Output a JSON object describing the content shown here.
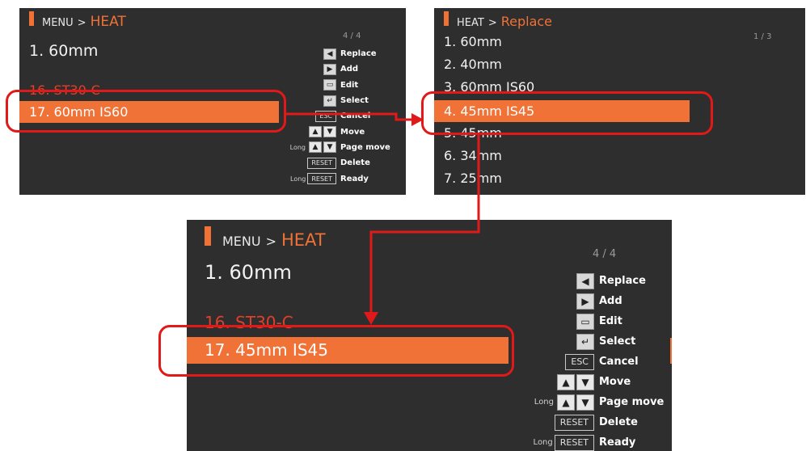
{
  "colors": {
    "accent": "#f07236",
    "highlight_border": "#e11919",
    "screen_bg": "#2e2e2e",
    "faded_item": "#e0402a"
  },
  "screen1": {
    "breadcrumb": {
      "parent": "MENU",
      "separator": ">",
      "current": "HEAT"
    },
    "page_indicator": "4 / 4",
    "items": [
      {
        "label": "1. 60mm",
        "state": "normal"
      },
      {
        "label": "16. ST30-C",
        "state": "faded"
      },
      {
        "label": "17. 60mm IS60",
        "state": "selected"
      }
    ],
    "commands": [
      {
        "long": "",
        "keys": [
          "left-arrow-icon"
        ],
        "label": "Replace"
      },
      {
        "long": "",
        "keys": [
          "right-arrow-icon"
        ],
        "label": "Add"
      },
      {
        "long": "",
        "keys": [
          "edit-icon"
        ],
        "label": "Edit"
      },
      {
        "long": "",
        "keys": [
          "enter-icon"
        ],
        "label": "Select"
      },
      {
        "long": "",
        "keys": [
          "ESC"
        ],
        "label": "Cancel"
      },
      {
        "long": "",
        "keys": [
          "up-arrow-icon",
          "down-arrow-icon"
        ],
        "label": "Move"
      },
      {
        "long": "Long",
        "keys": [
          "up-arrow-icon",
          "down-arrow-icon"
        ],
        "label": "Page move"
      },
      {
        "long": "",
        "keys": [
          "RESET"
        ],
        "label": "Delete"
      },
      {
        "long": "Long",
        "keys": [
          "RESET"
        ],
        "label": "Ready"
      }
    ]
  },
  "screen2": {
    "breadcrumb": {
      "parent": "HEAT",
      "separator": ">",
      "current": "Replace"
    },
    "page_indicator": "1 / 3",
    "items": [
      {
        "label": "1. 60mm",
        "state": "normal"
      },
      {
        "label": "2. 40mm",
        "state": "normal"
      },
      {
        "label": "3. 60mm IS60",
        "state": "normal"
      },
      {
        "label": "4. 45mm IS45",
        "state": "selected"
      },
      {
        "label": "5. 45mm",
        "state": "normal"
      },
      {
        "label": "6. 34mm",
        "state": "normal"
      },
      {
        "label": "7. 25mm",
        "state": "normal"
      }
    ]
  },
  "screen3": {
    "breadcrumb": {
      "parent": "MENU",
      "separator": ">",
      "current": "HEAT"
    },
    "page_indicator": "4 / 4",
    "items": [
      {
        "label": "1. 60mm",
        "state": "normal"
      },
      {
        "label": "16. ST30-C",
        "state": "faded"
      },
      {
        "label": "17. 45mm IS45",
        "state": "selected"
      }
    ]
  }
}
